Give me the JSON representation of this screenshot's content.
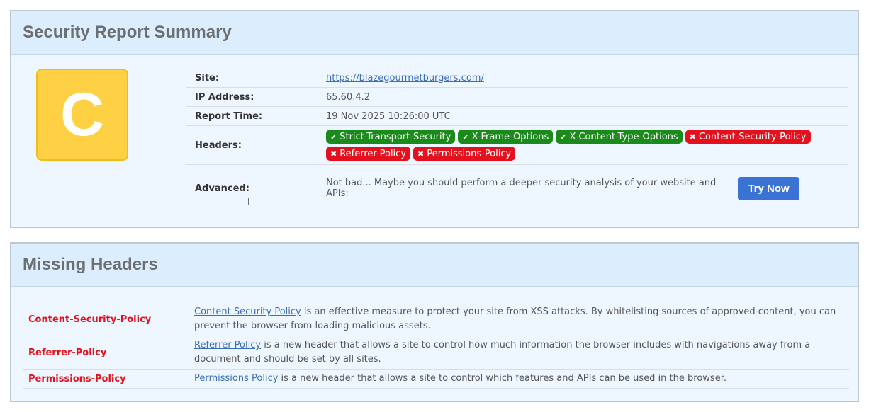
{
  "summary": {
    "title": "Security Report Summary",
    "grade": "C",
    "site_label": "Site:",
    "site_url": "https://blazegourmetburgers.com/",
    "ip_label": "IP Address:",
    "ip_value": "65.60.4.2",
    "time_label": "Report Time:",
    "time_value": "19 Nov 2025 10:26:00 UTC",
    "headers_label": "Headers:",
    "headers": [
      {
        "name": "Strict-Transport-Security",
        "status": "present",
        "icon": "check-icon"
      },
      {
        "name": "X-Frame-Options",
        "status": "present",
        "icon": "check-icon"
      },
      {
        "name": "X-Content-Type-Options",
        "status": "present",
        "icon": "check-icon"
      },
      {
        "name": "Content-Security-Policy",
        "status": "missing",
        "icon": "cross-icon"
      },
      {
        "name": "Referrer-Policy",
        "status": "missing",
        "icon": "cross-icon"
      },
      {
        "name": "Permissions-Policy",
        "status": "missing",
        "icon": "cross-icon"
      }
    ],
    "advanced_label": "Advanced:",
    "advanced_text": "Not bad... Maybe you should perform a deeper security analysis of your website and APIs:",
    "try_button": "Try Now"
  },
  "missing": {
    "title": "Missing Headers",
    "rows": [
      {
        "header": "Content-Security-Policy",
        "link_text": "Content Security Policy",
        "description": " is an effective measure to protect your site from XSS attacks. By whitelisting sources of approved content, you can prevent the browser from loading malicious assets."
      },
      {
        "header": "Referrer-Policy",
        "link_text": "Referrer Policy",
        "description": " is a new header that allows a site to control how much information the browser includes with navigations away from a document and should be set by all sites."
      },
      {
        "header": "Permissions-Policy",
        "link_text": "Permissions Policy",
        "description": " is a new header that allows a site to control which features and APIs can be used in the browser."
      }
    ]
  },
  "colors": {
    "grade_bg": "#fdd143",
    "present": "#1a8a1a",
    "missing": "#e3101d",
    "button": "#3a73d4",
    "link": "#3a6fb8"
  }
}
